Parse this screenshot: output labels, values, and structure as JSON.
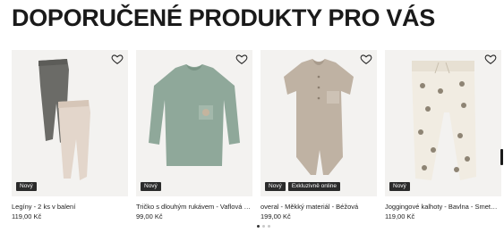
{
  "heading": "DOPORUČENÉ PRODUKTY PRO VÁS",
  "products": [
    {
      "name": "Legíny - 2 ks v balení",
      "price": "119,00 Kč",
      "badges": [
        "Nový"
      ],
      "wishlist_icon": "heart-outline-icon"
    },
    {
      "name": "Tričko s dlouhým rukávem - Vaflová struktura",
      "price": "99,00 Kč",
      "badges": [
        "Nový"
      ],
      "wishlist_icon": "heart-outline-icon"
    },
    {
      "name": "overal - Měkký materiál - Béžová",
      "price": "199,00 Kč",
      "badges": [
        "Nový",
        "Exkluzivně online"
      ],
      "wishlist_icon": "heart-outline-icon"
    },
    {
      "name": "Joggingové kalhoty - Bavlna - Smetanová",
      "price": "119,00 Kč",
      "badges": [
        "Nový"
      ],
      "wishlist_icon": "heart-outline-icon"
    }
  ],
  "pagination": {
    "count": 3,
    "active": 1
  },
  "colors": {
    "badge_bg": "#2b2b2b",
    "image_bg": "#f3f2f0",
    "leggings_dark": "#6b6b67",
    "leggings_pink": "#e3d6cb",
    "shirt_green": "#8fa89a",
    "romper_beige": "#bfb2a3",
    "joggers_cream": "#f1ece2"
  }
}
